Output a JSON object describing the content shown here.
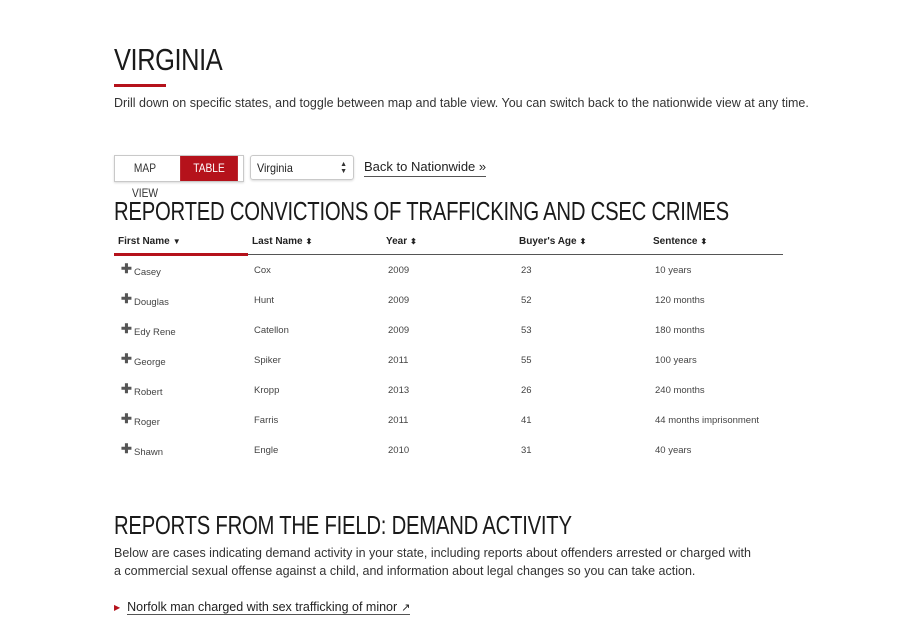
{
  "page": {
    "title": "VIRGINIA",
    "intro": "Drill down on specific states, and toggle between map and table view. You can switch back to the nationwide view at any time."
  },
  "controls": {
    "map_view": "MAP VIEW",
    "table_view": "TABLE VIEW",
    "state_selected": "Virginia",
    "back_link": "Back to Nationwide »",
    "accent_color": "#b5121b"
  },
  "convictions": {
    "heading": "REPORTED CONVICTIONS OF TRAFFICKING AND CSEC CRIMES",
    "columns": [
      {
        "label": "First Name",
        "sort_icon": "▼"
      },
      {
        "label": "Last Name",
        "sort_icon": "⬍"
      },
      {
        "label": "Year",
        "sort_icon": "⬍"
      },
      {
        "label": "Buyer's Age",
        "sort_icon": "⬍"
      },
      {
        "label": "Sentence",
        "sort_icon": "⬍"
      }
    ],
    "rows": [
      {
        "first": "Casey",
        "last": "Cox",
        "year": "2009",
        "age": "23",
        "sentence": "10 years"
      },
      {
        "first": "Douglas",
        "last": "Hunt",
        "year": "2009",
        "age": "52",
        "sentence": "120 months"
      },
      {
        "first": "Edy Rene",
        "last": "Catellon",
        "year": "2009",
        "age": "53",
        "sentence": "180 months"
      },
      {
        "first": "George",
        "last": "Spiker",
        "year": "2011",
        "age": "55",
        "sentence": "100 years"
      },
      {
        "first": "Robert",
        "last": "Kropp",
        "year": "2013",
        "age": "26",
        "sentence": "240 months"
      },
      {
        "first": "Roger",
        "last": "Farris",
        "year": "2011",
        "age": "41",
        "sentence": "44 months imprisonment"
      },
      {
        "first": "Shawn",
        "last": "Engle",
        "year": "2010",
        "age": "31",
        "sentence": "40 years"
      }
    ]
  },
  "reports": {
    "heading": "REPORTS FROM THE FIELD: DEMAND ACTIVITY",
    "text": "Below are cases indicating demand activity in your state, including reports about offenders arrested or charged with a commercial sexual offense against a child, and information about legal changes so you can take action.",
    "items": [
      {
        "label": "Norfolk man charged with sex trafficking of minor",
        "icon": "external-link-icon"
      }
    ]
  }
}
